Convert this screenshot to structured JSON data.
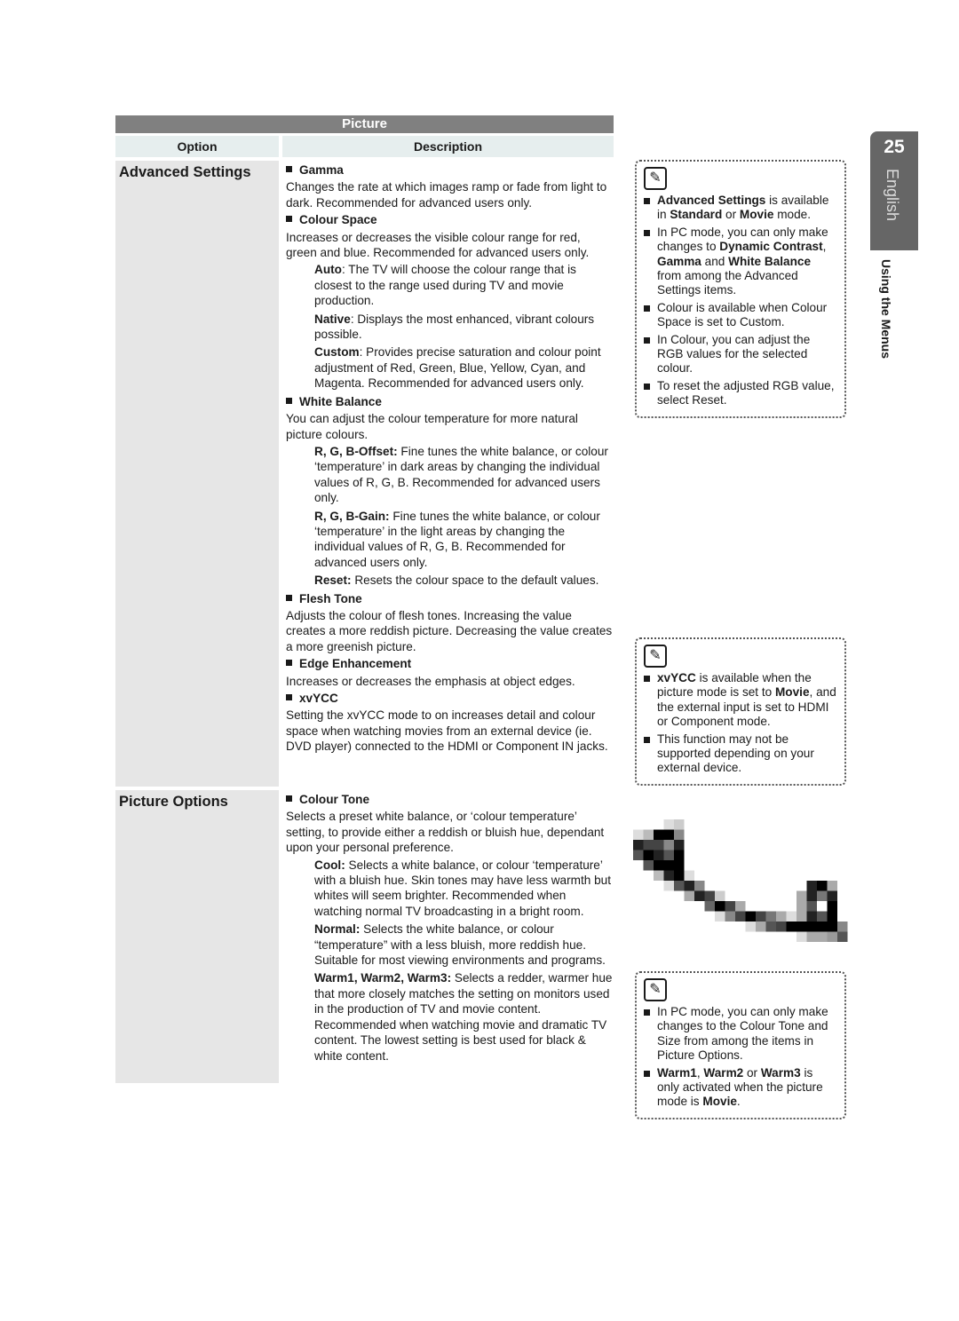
{
  "table": {
    "title": "Picture",
    "headers": {
      "option": "Option",
      "description": "Description"
    },
    "rows": [
      {
        "option": "Advanced Settings",
        "sections": [
          {
            "title": "Gamma",
            "text": "Changes the rate at which images ramp or fade from light to dark. Recommended for advanced users only.",
            "subs": []
          },
          {
            "title": "Colour Space",
            "text": "Increases or decreases the visible colour range for red, green and blue. Recommended for advanced users only.",
            "subs": [
              {
                "label": "Auto",
                "text": ": The TV will choose the colour range that is closest to the range used during TV and movie production."
              },
              {
                "label": "Native",
                "text": ": Displays the most enhanced, vibrant colours possible."
              },
              {
                "label": "Custom",
                "text": ": Provides precise saturation and colour point adjustment of Red, Green, Blue, Yellow, Cyan, and Magenta. Recommended for advanced users only."
              }
            ]
          },
          {
            "title": "White Balance",
            "text": "You can adjust the colour temperature for more natural picture colours.",
            "subs": [
              {
                "label": "R, G, B-Offset:",
                "text": " Fine tunes the white balance, or colour ‘temperature’ in dark areas by changing the individual values of R, G, B. Recommended for advanced users only."
              },
              {
                "label": "R, G, B-Gain:",
                "text": " Fine tunes the white balance, or colour ‘temperature’ in the light areas by changing the individual values of R, G, B. Recommended for advanced users only."
              },
              {
                "label": "Reset:",
                "text": " Resets the colour space to the default values."
              }
            ]
          },
          {
            "title": "Flesh Tone",
            "text": "Adjusts the colour of flesh tones. Increasing the value creates a more reddish picture. Decreasing the value creates a more greenish picture.",
            "subs": []
          },
          {
            "title": "Edge Enhancement",
            "text": "Increases or decreases the emphasis at object edges.",
            "subs": []
          },
          {
            "title": "xvYCC",
            "text": "Setting the xvYCC mode to on increases detail and colour space when watching movies from an external device (ie. DVD player) connected to the HDMI or Component IN jacks.",
            "subs": []
          }
        ]
      },
      {
        "option": "Picture Options",
        "sections": [
          {
            "title": "Colour Tone",
            "text": "Selects a preset white balance, or ‘colour temperature’ setting, to provide either a reddish or bluish hue, dependant upon your personal preference.",
            "subs": [
              {
                "label": "Cool:",
                "text": " Selects a white balance, or colour ‘temperature’ with a bluish hue. Skin tones may have less warmth but whites will seem brighter. Recommended when watching normal TV broadcasting in a bright room."
              },
              {
                "label": "Normal:",
                "text": " Selects the white balance, or colour “temperature” with a less bluish, more reddish hue. Suitable for most viewing environments and programs."
              },
              {
                "label": "Warm1, Warm2, Warm3:",
                "text": " Selects a redder, warmer hue that more closely matches the setting on monitors used in the production of TV and movie content. Recommended when watching movie and dramatic TV content. The lowest setting is best used for black & white content."
              }
            ]
          }
        ]
      }
    ]
  },
  "notes": [
    {
      "icon": "note-pencil-icon",
      "items": [
        [
          {
            "b": "Advanced Settings"
          },
          {
            "t": " is available in "
          },
          {
            "b": "Standard"
          },
          {
            "t": " or "
          },
          {
            "b": "Movie"
          },
          {
            "t": " mode."
          }
        ],
        [
          {
            "t": "In PC mode, you can only make changes to "
          },
          {
            "b": "Dynamic Contrast"
          },
          {
            "t": ", "
          },
          {
            "b": "Gamma"
          },
          {
            "t": " and "
          },
          {
            "b": "White Balance"
          },
          {
            "t": " from among the Advanced Settings items."
          }
        ],
        [
          {
            "t": "Colour is available when Colour Space is set to Custom."
          }
        ],
        [
          {
            "t": "In Colour, you can adjust the RGB values for the selected colour."
          }
        ],
        [
          {
            "t": "To reset the adjusted RGB value, select Reset."
          }
        ]
      ]
    },
    {
      "icon": "note-pencil-icon",
      "items": [
        [
          {
            "b": "xvYCC"
          },
          {
            "t": " is available when the picture mode is set to "
          },
          {
            "b": "Movie"
          },
          {
            "t": ", and the external input is set to HDMI or Component mode."
          }
        ],
        [
          {
            "t": "This function may not be supported depending on your external device."
          }
        ]
      ]
    },
    {
      "icon": "note-pencil-icon",
      "items": [
        [
          {
            "t": "In PC mode, you can only make changes to the Colour Tone and Size from among the items in Picture Options."
          }
        ],
        [
          {
            "b": "Warm1"
          },
          {
            "t": ", "
          },
          {
            "b": "Warm2"
          },
          {
            "t": " or "
          },
          {
            "b": "Warm3"
          },
          {
            "t": " is only activated when the picture mode is "
          },
          {
            "b": "Movie"
          },
          {
            "t": "."
          }
        ]
      ]
    }
  ],
  "side_tab": {
    "page_number": "25",
    "language": "English",
    "section": "Using the Menus"
  },
  "colors": {
    "title_bar": "#808080",
    "header_cell": "#e6eeee",
    "option_cell": "#e6e6e6",
    "side_tab": "#666666"
  }
}
